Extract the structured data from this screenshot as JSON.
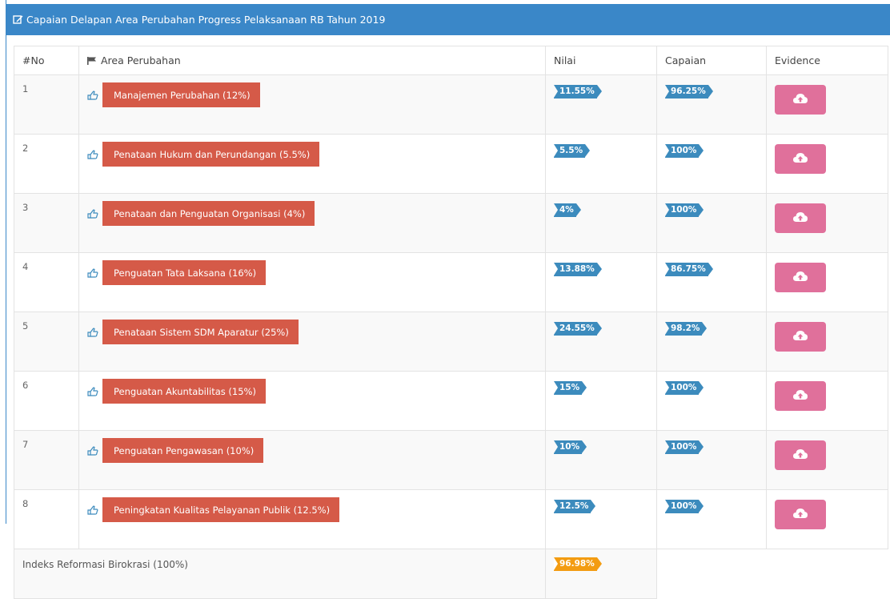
{
  "panel": {
    "title": "Capaian Delapan Area Perubahan Progress Pelaksanaan RB Tahun 2019",
    "title_icon": "edit-icon"
  },
  "table": {
    "headers": {
      "no": "#No",
      "area": "Area Perubahan",
      "area_icon": "flag-icon",
      "nilai": "Nilai",
      "capaian": "Capaian",
      "evidence": "Evidence"
    },
    "rows": [
      {
        "no": "1",
        "area": "Manajemen Perubahan (12%)",
        "nilai": "11.55%",
        "capaian": "96.25%"
      },
      {
        "no": "2",
        "area": "Penataan Hukum dan Perundangan (5.5%)",
        "nilai": "5.5%",
        "capaian": "100%"
      },
      {
        "no": "3",
        "area": "Penataan dan Penguatan Organisasi (4%)",
        "nilai": "4%",
        "capaian": "100%"
      },
      {
        "no": "4",
        "area": "Penguatan Tata Laksana (16%)",
        "nilai": "13.88%",
        "capaian": "86.75%"
      },
      {
        "no": "5",
        "area": "Penataan Sistem SDM Aparatur (25%)",
        "nilai": "24.55%",
        "capaian": "98.2%"
      },
      {
        "no": "6",
        "area": "Penguatan Akuntabilitas (15%)",
        "nilai": "15%",
        "capaian": "100%"
      },
      {
        "no": "7",
        "area": "Penguatan Pengawasan (10%)",
        "nilai": "10%",
        "capaian": "100%"
      },
      {
        "no": "8",
        "area": "Peningkatan Kualitas Pelayanan Publik (12.5%)",
        "nilai": "12.5%",
        "capaian": "100%"
      }
    ],
    "footer": {
      "label": "Indeks Reformasi Birokrasi (100%)",
      "value": "96.98%"
    }
  },
  "icons": {
    "row_icon": "hand-pointer-icon",
    "evidence_icon": "cloud-upload-icon"
  },
  "colors": {
    "header_bg": "#3a87c8",
    "area_label_bg": "#d55a48",
    "tag_blue": "#3c8bbd",
    "tag_orange": "#f39c12",
    "upload_button": "#e0709b"
  }
}
